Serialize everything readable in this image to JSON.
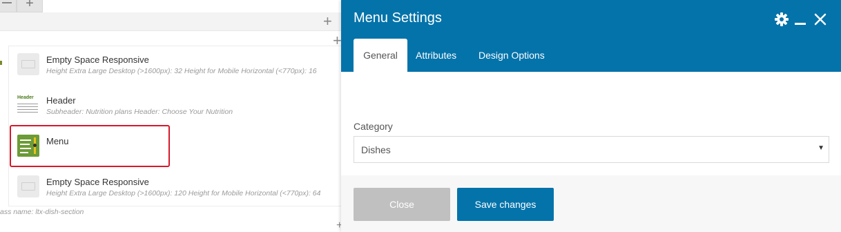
{
  "builder": {
    "elements": [
      {
        "title": "Empty Space Responsive",
        "subtitle": "Height Extra Large Desktop (>1600px): 32  Height for Mobile Horizontal (<770px): 16",
        "icon": "empty-space-icon"
      },
      {
        "title": "Header",
        "subtitle": "Subheader: Nutrition plans  Header: Choose Your Nutrition",
        "icon": "header-icon",
        "icon_label": "Header"
      },
      {
        "title": "Menu",
        "subtitle": "",
        "icon": "menu-icon"
      },
      {
        "title": "Empty Space Responsive",
        "subtitle": "Height Extra Large Desktop (>1600px): 120  Height for Mobile Horizontal (<770px): 64",
        "icon": "empty-space-icon"
      }
    ],
    "class_note": "ass name: ltx-dish-section",
    "add_symbol": "+"
  },
  "panel": {
    "title": "Menu Settings",
    "tabs": [
      {
        "label": "General",
        "active": true
      },
      {
        "label": "Attributes",
        "active": false
      },
      {
        "label": "Design Options",
        "active": false
      }
    ],
    "category_label": "Category",
    "category_value": "Dishes",
    "close_label": "Close",
    "save_label": "Save changes"
  },
  "colors": {
    "accent": "#0473aa",
    "highlight": "#d6182b",
    "menu_icon": "#6c9b37"
  }
}
